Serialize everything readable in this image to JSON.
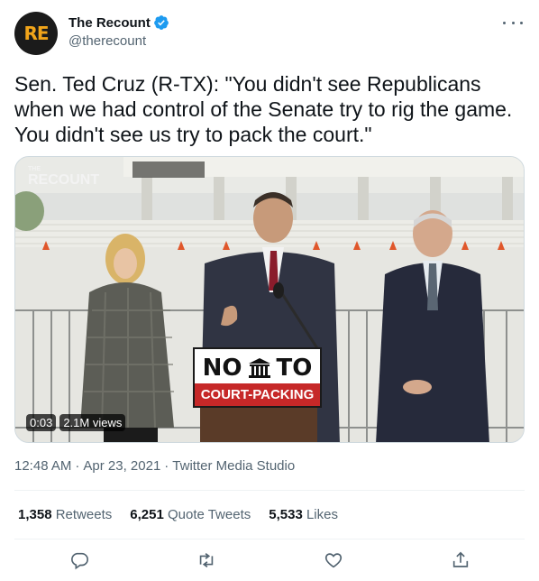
{
  "account": {
    "display_name": "The Recount",
    "handle": "@therecount",
    "avatar_text": "RE",
    "verified_icon": "verified-badge-icon",
    "brand_color": "#f2a51a",
    "verified_color": "#1d9bf0"
  },
  "tweet": {
    "text": "Sen. Ted Cruz (R-TX): \"You didn't see Republicans when we had control of the Senate try to rig the game. You didn't see us try to pack the court.\""
  },
  "media": {
    "watermark": "RECOUNT",
    "watermark_small": "THE",
    "time": "0:03",
    "views": "2.1M views",
    "sign_left": "NO",
    "sign_right": "TO",
    "sign_bottom": "COURT-PACKING"
  },
  "meta": {
    "time": "12:48 AM",
    "separator": "·",
    "date": "Apr 23, 2021",
    "source": "Twitter Media Studio"
  },
  "stats": {
    "retweets_count": "1,358",
    "retweets_label": "Retweets",
    "quotes_count": "6,251",
    "quotes_label": "Quote Tweets",
    "likes_count": "5,533",
    "likes_label": "Likes"
  },
  "actions": [
    "reply-icon",
    "retweet-icon",
    "like-icon",
    "share-icon"
  ],
  "icon_color": "#536471"
}
